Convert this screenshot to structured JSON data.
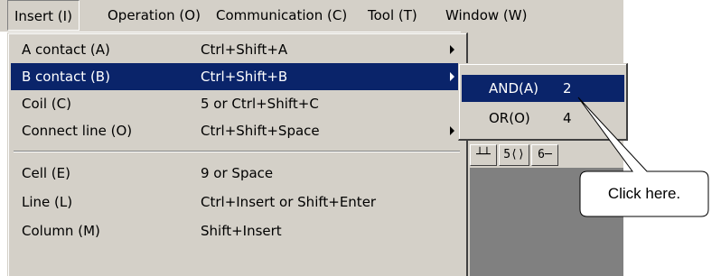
{
  "menubar": {
    "items": [
      {
        "label": "Insert (I)"
      },
      {
        "label": "Operation (O)"
      },
      {
        "label": "Communication (C)"
      },
      {
        "label": "Tool (T)"
      },
      {
        "label": "Window (W)"
      }
    ]
  },
  "insert_menu": {
    "items": [
      {
        "label": "A contact (A)",
        "shortcut": "Ctrl+Shift+A"
      },
      {
        "label": "B contact (B)",
        "shortcut": "Ctrl+Shift+B"
      },
      {
        "label": "Coil (C)",
        "shortcut": "5 or Ctrl+Shift+C"
      },
      {
        "label": "Connect line (O)",
        "shortcut": "Ctrl+Shift+Space"
      },
      {
        "label": "Cell (E)",
        "shortcut": "9 or Space"
      },
      {
        "label": "Line (L)",
        "shortcut": "Ctrl+Insert or Shift+Enter"
      },
      {
        "label": "Column (M)",
        "shortcut": "Shift+Insert"
      }
    ]
  },
  "submenu": {
    "items": [
      {
        "label": "AND(A)",
        "number": "2"
      },
      {
        "label": "OR(O)",
        "number": "4"
      }
    ]
  },
  "toolbar": {
    "buttons": [
      "┘̸",
      "─̸",
      "⌂"
    ],
    "buttons2": [
      "┴┴",
      "5⟨⟩",
      "6─"
    ]
  },
  "callout": {
    "text": "Click here."
  },
  "colors": {
    "menu_bg": "#d4d0c8",
    "highlight": "#0a246a",
    "dark_area": "#808080"
  }
}
